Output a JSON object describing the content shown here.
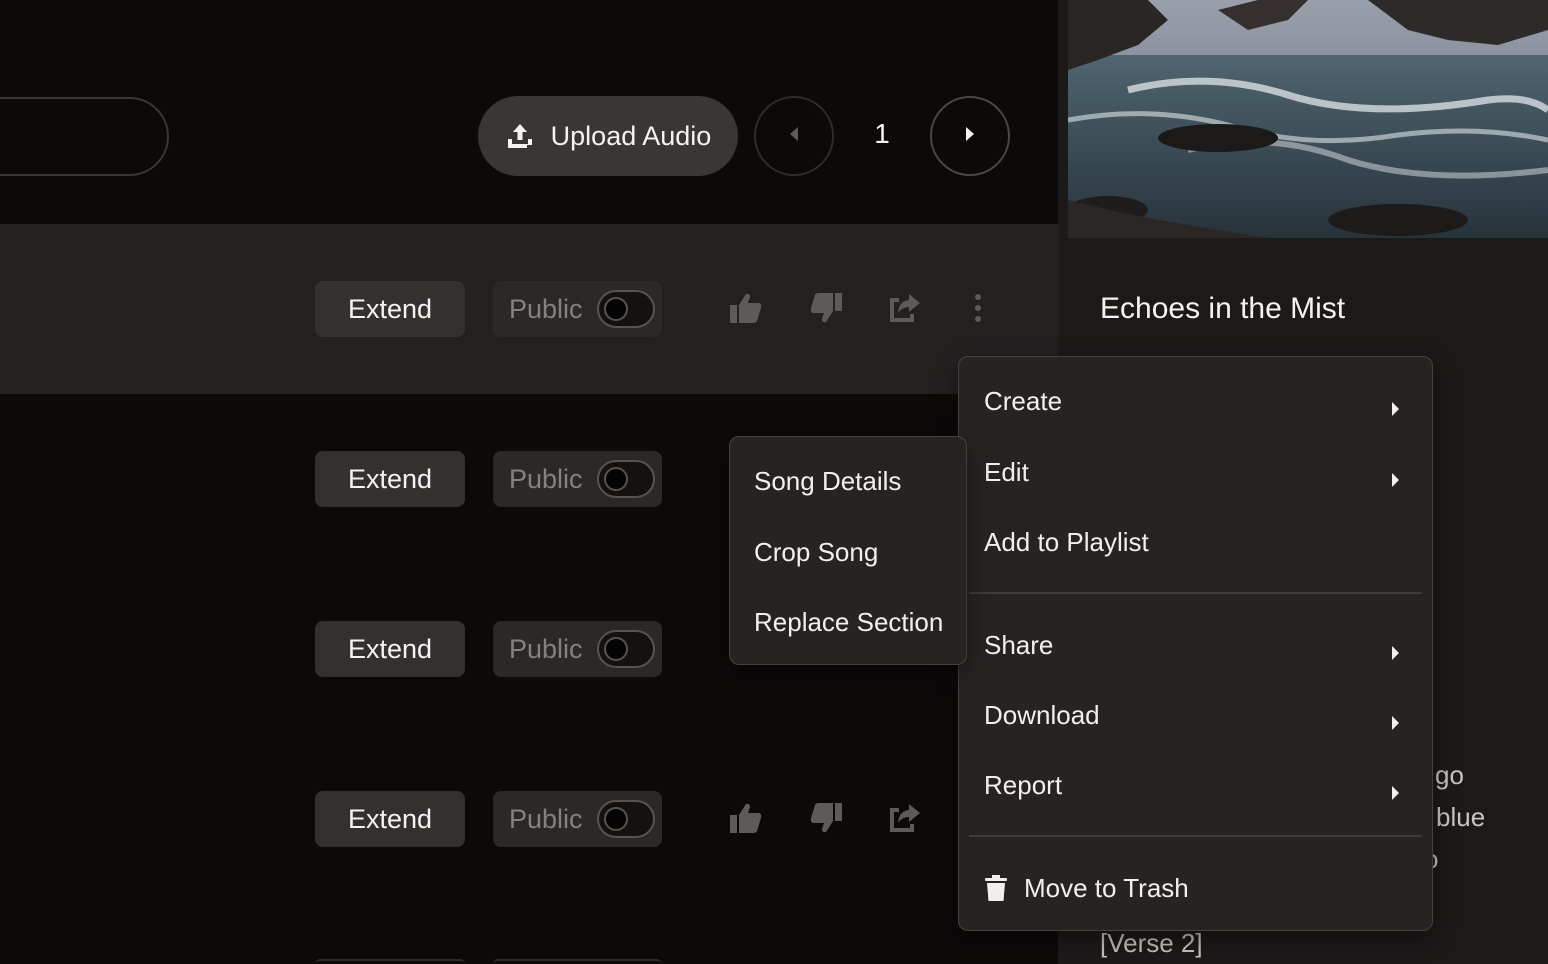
{
  "toolbar": {
    "upload_label": "Upload Audio",
    "page_number": "1"
  },
  "rows": [
    {
      "extend_label": "Extend",
      "public_label": "Public"
    },
    {
      "extend_label": "Extend",
      "public_label": "Public"
    },
    {
      "extend_label": "Extend",
      "public_label": "Public"
    },
    {
      "extend_label": "Extend",
      "public_label": "Public"
    }
  ],
  "detail": {
    "title": "Echoes in the Mist",
    "lyrics_fragments": [
      "/",
      "l go",
      "blue",
      "o",
      "[Verse 2]"
    ]
  },
  "context_menu": {
    "items": [
      {
        "label": "Create",
        "has_submenu": true
      },
      {
        "label": "Edit",
        "has_submenu": true
      },
      {
        "label": "Add to Playlist",
        "has_submenu": false
      },
      {
        "label": "Share",
        "has_submenu": true
      },
      {
        "label": "Download",
        "has_submenu": true
      },
      {
        "label": "Report",
        "has_submenu": true
      }
    ],
    "trash_label": "Move to Trash"
  },
  "edit_submenu": {
    "items": [
      {
        "label": "Song Details"
      },
      {
        "label": "Crop Song"
      },
      {
        "label": "Replace Section"
      }
    ]
  },
  "colors": {
    "background": "#0c0a09",
    "row_highlight": "#232120",
    "menu_bg": "#262423",
    "panel_bg": "#1c1a19",
    "text": "#f2f0ee",
    "muted_text": "#86817e"
  },
  "icons": {
    "upload": "upload-icon",
    "prev": "triangle-left-icon",
    "next": "triangle-right-icon",
    "like": "thumbs-up-icon",
    "dislike": "thumbs-down-icon",
    "share": "share-icon",
    "more": "more-vertical-icon",
    "trash": "trash-icon"
  }
}
